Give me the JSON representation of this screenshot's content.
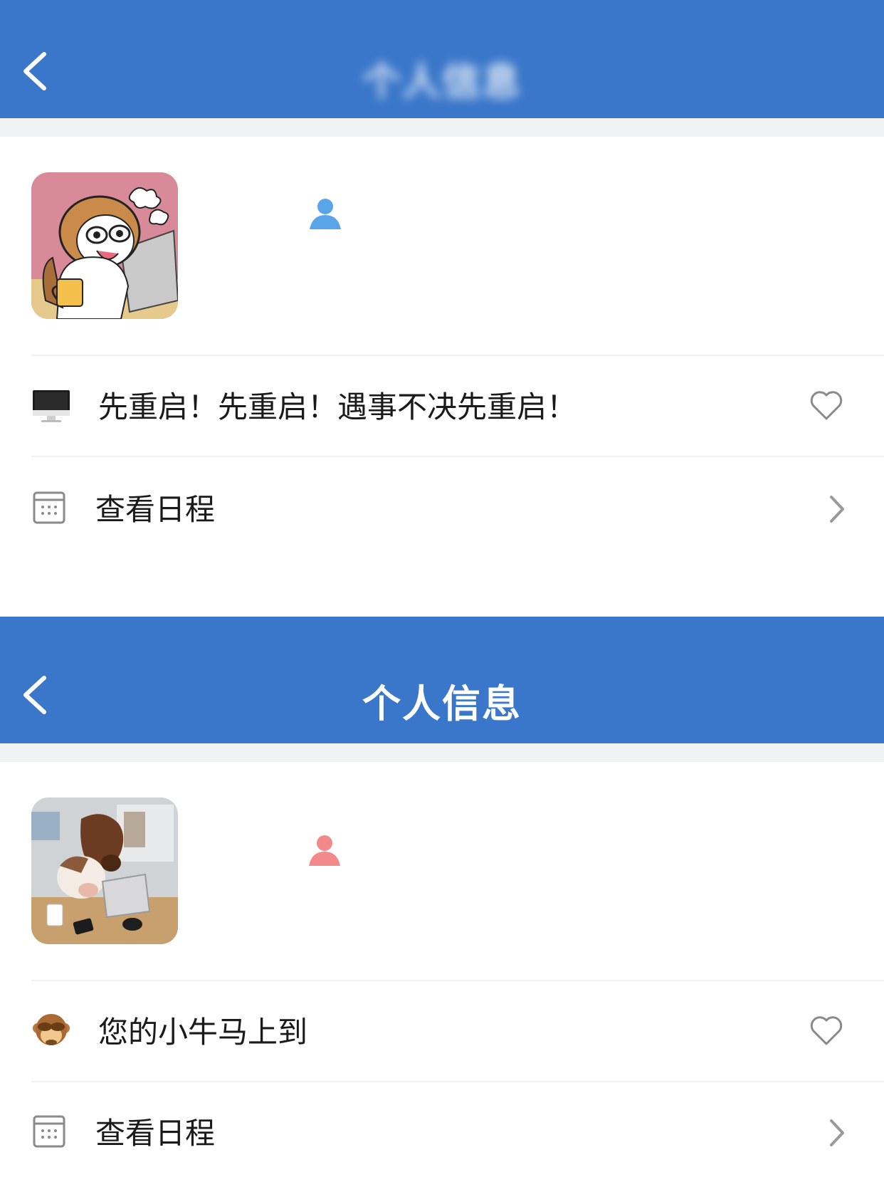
{
  "screens": [
    {
      "nav": {
        "title": "个人信息"
      },
      "status_text": "先重启！先重启！遇事不决先重启！",
      "status_emoji": "desktop-computer-icon",
      "schedule_label": "查看日程",
      "gender": "male",
      "avatar": "dog-at-laptop-sticker",
      "gender_color": "#5aa4e8"
    },
    {
      "nav": {
        "title": "个人信息"
      },
      "status_text": "您的小牛马上到",
      "status_emoji": "see-no-evil-monkey-icon",
      "schedule_label": "查看日程",
      "gender": "female",
      "avatar": "cow-and-horse-at-desk-photo",
      "gender_color": "#f2898a"
    }
  ],
  "colors": {
    "nav_bg": "#3a76c9",
    "separator": "#f0f2f4"
  }
}
